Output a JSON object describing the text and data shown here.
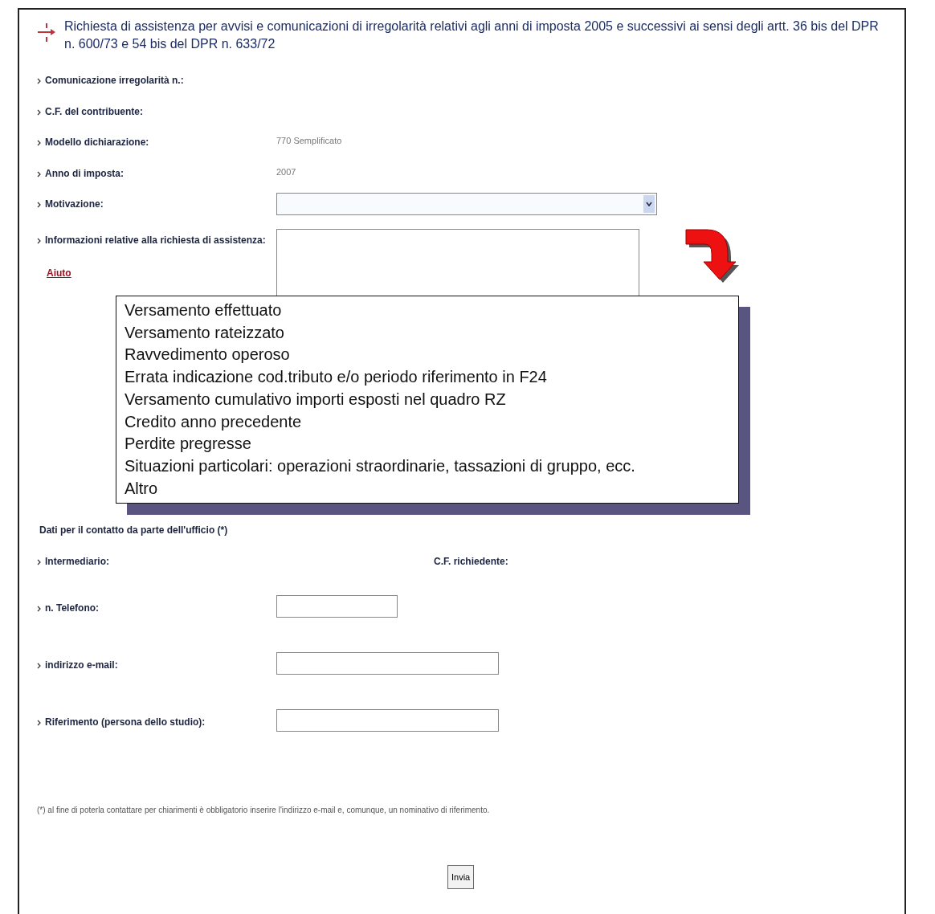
{
  "title": "Richiesta di assistenza per avvisi e comunicazioni di irregolarità relativi agli anni di imposta 2005 e successivi ai sensi degli artt. 36 bis del DPR n. 600/73 e 54 bis del DPR n. 633/72",
  "info_rows": [
    {
      "label": "Comunicazione irregolarità n.:"
    },
    {
      "label": "C.F. del contribuente:"
    },
    {
      "label": "Modello dichiarazione:",
      "value": "770 Semplificato"
    },
    {
      "label": "Anno di imposta:",
      "value": "2007"
    }
  ],
  "motivazione": {
    "label": "Motivazione:",
    "expanded": true,
    "options": [
      "Versamento effettuato",
      "Versamento rateizzato",
      "Ravvedimento operoso",
      "Errata indicazione cod.tributo e/o periodo riferimento in F24",
      "Versamento cumulativo importi esposti nel quadro RZ",
      "Credito anno precedente",
      "Perdite pregresse",
      "Situazioni particolari: operazioni straordinarie, tassazioni di gruppo, ecc.",
      "Altro"
    ]
  },
  "informazioni": {
    "label": "Informazioni relative alla richiesta di assistenza:",
    "help_link": "Aiuto"
  },
  "contact_heading": "Dati per il contatto da parte dell'ufficio (*)",
  "intermediario": {
    "label": "Intermediario:",
    "cf_label": "C.F. richiedente:"
  },
  "contact_fields": [
    {
      "label": "n. Telefono:",
      "kind": "short"
    },
    {
      "label": "indirizzo e-mail:",
      "kind": "long"
    },
    {
      "label": "Riferimento (persona dello studio):",
      "kind": "long"
    }
  ],
  "footnote": "(*) al fine di poterla contattare per chiarimenti è obbligatorio inserire l'indirizzo e-mail e, comunque, un nominativo di riferimento.",
  "submit_button": "Invia"
}
